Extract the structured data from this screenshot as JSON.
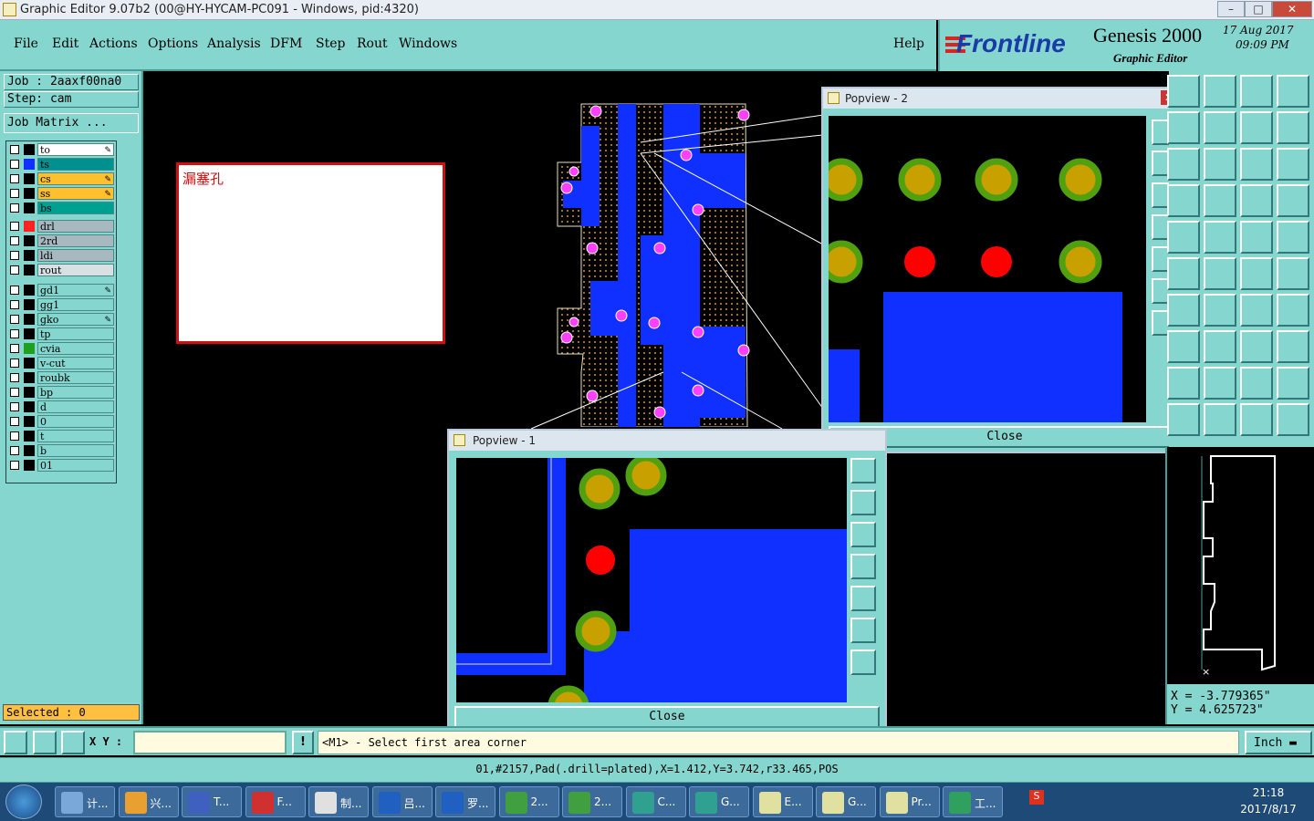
{
  "window": {
    "title": "Graphic Editor 9.07b2 (00@HY-HYCAM-PC091 - Windows, pid:4320)"
  },
  "menu": [
    "File",
    "Edit",
    "Actions",
    "Options",
    "Analysis",
    "DFM",
    "Step",
    "Rout",
    "Windows"
  ],
  "help": "Help",
  "logo": {
    "brand": "Frontline",
    "product": "Genesis 2000",
    "subtitle": "Graphic Editor",
    "date": "17 Aug 2017",
    "time": "09:09 PM"
  },
  "job": {
    "job": "Job : 2aaxf00na0",
    "step": "Step: cam",
    "matrix": "Job Matrix ..."
  },
  "layers": [
    {
      "name": "to",
      "color": "#ffffff",
      "sw": "#000000",
      "mark": true
    },
    {
      "name": "ts",
      "color": "#009090",
      "sw": "#1030ff",
      "mark": false
    },
    {
      "name": "cs",
      "color": "#ffc030",
      "sw": "#000000",
      "mark": true
    },
    {
      "name": "ss",
      "color": "#ffc030",
      "sw": "#000000",
      "mark": true
    },
    {
      "name": "bs",
      "color": "#00a090",
      "sw": "#000000",
      "mark": false
    },
    {
      "name": "drl",
      "color": "#a8b8c0",
      "sw": "#ff2020",
      "mark": false
    },
    {
      "name": "2rd",
      "color": "#a8b8c0",
      "sw": "#000000",
      "mark": false
    },
    {
      "name": "ldi",
      "color": "#a8b8c0",
      "sw": "#000000",
      "mark": false
    },
    {
      "name": "rout",
      "color": "#d8e0e4",
      "sw": "#000000",
      "mark": false
    },
    {
      "name": "gd1",
      "color": "#86d6d0",
      "sw": "#000000",
      "mark": true
    },
    {
      "name": "gg1",
      "color": "#86d6d0",
      "sw": "#000000",
      "mark": false
    },
    {
      "name": "gko",
      "color": "#86d6d0",
      "sw": "#000000",
      "mark": true
    },
    {
      "name": "tp",
      "color": "#86d6d0",
      "sw": "#000000",
      "mark": false
    },
    {
      "name": "cvia",
      "color": "#86d6d0",
      "sw": "#20a020",
      "mark": false
    },
    {
      "name": "v-cut",
      "color": "#86d6d0",
      "sw": "#000000",
      "mark": false
    },
    {
      "name": "roubk",
      "color": "#86d6d0",
      "sw": "#000000",
      "mark": false
    },
    {
      "name": "bp",
      "color": "#86d6d0",
      "sw": "#000000",
      "mark": false
    },
    {
      "name": "d",
      "color": "#86d6d0",
      "sw": "#000000",
      "mark": false
    },
    {
      "name": "0",
      "color": "#86d6d0",
      "sw": "#000000",
      "mark": false
    },
    {
      "name": "t",
      "color": "#86d6d0",
      "sw": "#000000",
      "mark": false
    },
    {
      "name": "b",
      "color": "#86d6d0",
      "sw": "#000000",
      "mark": false
    },
    {
      "name": "01",
      "color": "#86d6d0",
      "sw": "#000000",
      "mark": false
    }
  ],
  "selected": "Selected : 0",
  "note": "漏塞孔",
  "popview1": {
    "title": "Popview - 1",
    "close": "Close"
  },
  "popview2": {
    "title": "Popview - 2",
    "close": "Close"
  },
  "coords": {
    "x": "X = -3.779365\"",
    "y": "Y = 4.625723\""
  },
  "cmd": {
    "xy_label": "X Y :",
    "xy_value": "",
    "prompt": "<M1> - Select first area corner",
    "units": "Inch"
  },
  "info": "01,#2157,Pad(.drill=plated),X=1.412,Y=3.742,r33.465,POS",
  "taskbar": {
    "items": [
      "计...",
      "兴...",
      "T...",
      "F...",
      "制...",
      "吕...",
      "罗...",
      "2...",
      "2...",
      "C...",
      "G...",
      "E...",
      "G...",
      "Pr...",
      "工..."
    ],
    "clock": "21:18",
    "date": "2017/8/17"
  },
  "colors": {
    "panel": "#86d6d0",
    "copper": "#1030ff",
    "pad": "#c8a000",
    "ring": "#50a010",
    "red": "#ff0000",
    "via": "#ff40ff"
  }
}
